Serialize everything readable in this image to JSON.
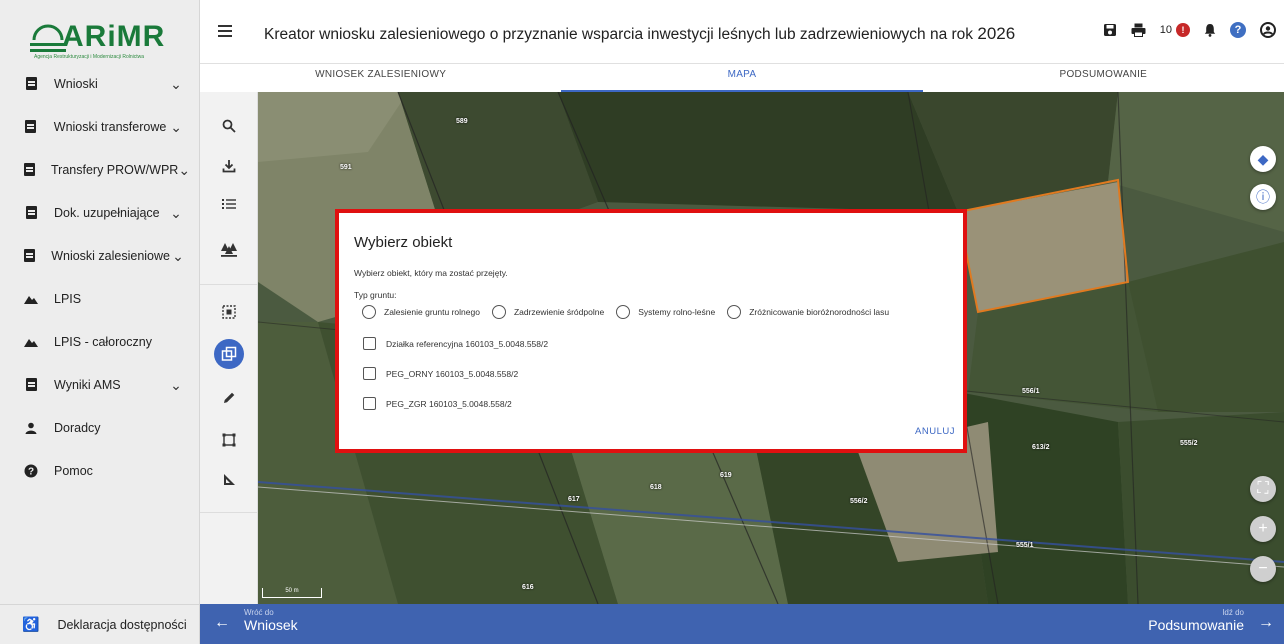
{
  "brand": {
    "logo_text": "ARiMR",
    "logo_sub": "Agencja Restrukturyzacji i Modernizacji Rolnictwa"
  },
  "sidebar": {
    "items": [
      {
        "label": "Wnioski",
        "icon": "document-icon",
        "chevron": true
      },
      {
        "label": "Wnioski transferowe",
        "icon": "document-icon",
        "chevron": true
      },
      {
        "label": "Transfery PROW/WPR",
        "icon": "document-icon",
        "chevron": true
      },
      {
        "label": "Dok. uzupełniające",
        "icon": "document-icon",
        "chevron": true
      },
      {
        "label": "Wnioski zalesieniowe",
        "icon": "document-icon",
        "chevron": true
      },
      {
        "label": "LPIS",
        "icon": "terrain-icon",
        "chevron": false
      },
      {
        "label": "LPIS - całoroczny",
        "icon": "terrain-icon",
        "chevron": false
      },
      {
        "label": "Wyniki AMS",
        "icon": "document-icon",
        "chevron": true
      },
      {
        "label": "Doradcy",
        "icon": "person-icon",
        "chevron": false
      },
      {
        "label": "Pomoc",
        "icon": "help-icon",
        "chevron": false
      }
    ],
    "footer_label": "Deklaracja dostępności"
  },
  "header": {
    "title": "Kreator wniosku zalesieniowego o przyznanie wsparcia inwestycji leśnych lub zadrzewieniowych na rok",
    "year": "2026",
    "notif_count": "10",
    "alert_badge": "!"
  },
  "tabs": [
    "WNIOSEK ZALESIENIOWY",
    "MAPA",
    "PODSUMOWANIE"
  ],
  "active_tab": 1,
  "map": {
    "parcel_labels": [
      "589",
      "591",
      "556/1",
      "555/2",
      "613/2",
      "617",
      "618",
      "619",
      "556/2",
      "555/1",
      "616"
    ],
    "scale_label": "50 m"
  },
  "dialog": {
    "title": "Wybierz obiekt",
    "description": "Wybierz obiekt, który ma zostać przejęty.",
    "type_label": "Typ gruntu:",
    "radios": [
      "Zalesienie gruntu rolnego",
      "Zadrzewienie śródpolne",
      "Systemy rolno-leśne",
      "Zróżnicowanie bioróżnorodności lasu"
    ],
    "checkboxes": [
      "Działka referencyjna 160103_5.0048.558/2",
      "PEG_ORNY 160103_5.0048.558/2",
      "PEG_ZGR 160103_5.0048.558/2"
    ],
    "cancel_label": "ANULUJ"
  },
  "bottombar": {
    "back_small": "Wróć do",
    "back_big": "Wniosek",
    "next_small": "Idź do",
    "next_big": "Podsumowanie"
  },
  "colors": {
    "accent": "#3d68c4",
    "bottombar": "#3f63b0",
    "highlight_border": "#e01010",
    "brand_green": "#1a7a3a"
  }
}
